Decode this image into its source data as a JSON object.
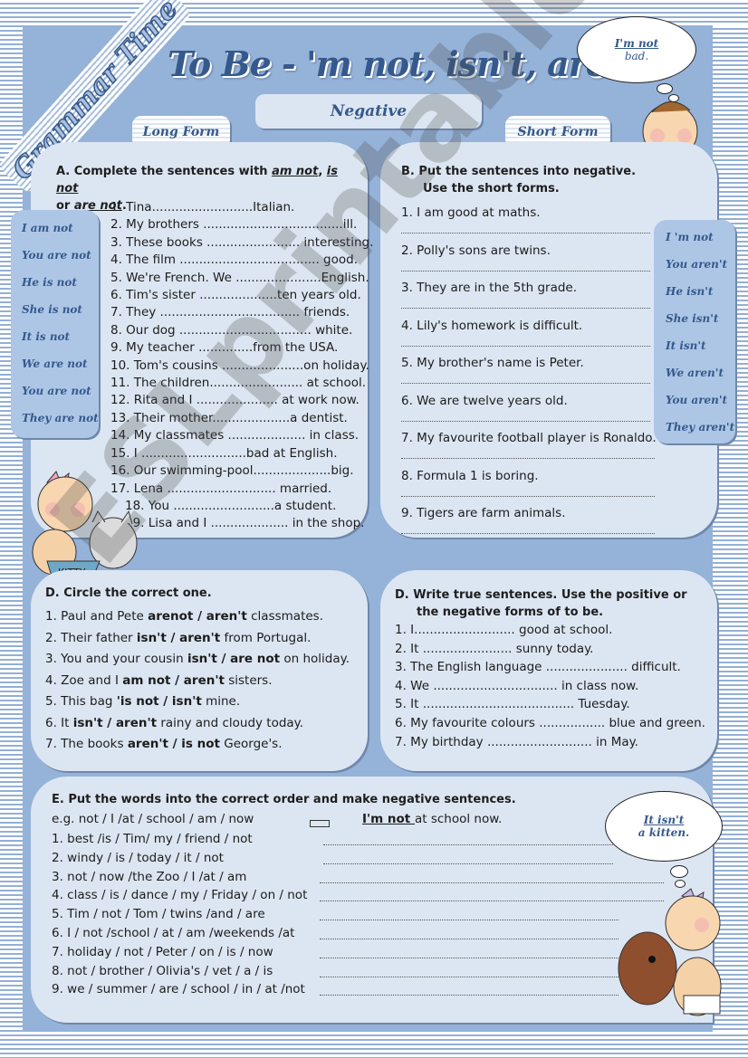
{
  "banner": "Grammar Time",
  "title": "To Be - 'm not, isn't, aren't",
  "header_pill": "Negative",
  "long_form_tab": "Long Form",
  "short_form_tab": "Short Form",
  "cloud_top": {
    "line1": "I'm not",
    "line2": "bad."
  },
  "cloud_bottom": {
    "line1": "It isn't",
    "line2": "a kitten."
  },
  "long_forms": [
    "I am not",
    "You are not",
    "He is not",
    "She is not",
    "It is not",
    "We are not",
    "You are not",
    "They are not"
  ],
  "short_forms": [
    "I 'm not",
    "You aren't",
    "He isn't",
    "She isn't",
    "It isn't",
    "We aren't",
    "You aren't",
    "They aren't"
  ],
  "section_a": {
    "title_pre": "A. Complete the sentences with ",
    "opt1": "am not",
    "sep": ",  ",
    "opt2": "is not",
    "or": "or ",
    "opt3": "are not",
    "end": ".",
    "items": [
      "1. Tina..........................Italian.",
      "2. My brothers ....................................ill.",
      "3. These books ........................ interesting.",
      "4. The film .................................... good.",
      "5. We're French. We ......................English.",
      "6. Tim's sister ....................ten years old.",
      "7. They .................................... friends.",
      "8. Our dog .................................. white.",
      "9. My teacher ..............from the USA.",
      "10. Tom's cousins .....................on holiday.",
      "11. The children........................ at school.",
      "12. Rita and I ..................... at work now.",
      "13. Their mother....................a dentist.",
      "14. My classmates .................... in class.",
      "15. I ...........................bad at English.",
      "16. Our swimming-pool....................big.",
      "17. Lena ............................ married.",
      "18. You ..........................a student.",
      "19. Lisa and I .................... in the shop."
    ]
  },
  "section_b": {
    "title_line1": "B. Put the sentences into negative.",
    "title_line2": "Use the short forms.",
    "items": [
      "1. I am good at maths.",
      "2. Polly's sons are twins.",
      "3. They are in the 5th grade.",
      "4. Lily's homework is difficult.",
      "5. My brother's name is Peter.",
      "6. We are twelve years old.",
      "7. My favourite football player is Ronaldo.",
      "8. Formula 1 is boring.",
      "9. Tigers are farm animals."
    ]
  },
  "section_c": {
    "title": "D. Circle the correct one.",
    "items": [
      {
        "pre": "1. Paul and Pete  ",
        "choice": "arenot / aren't",
        "post": " classmates."
      },
      {
        "pre": "2. Their father ",
        "choice": "isn't / aren't",
        "post": " from Portugal."
      },
      {
        "pre": "3. You and your cousin ",
        "choice": "isn't / are not",
        "post": " on holiday."
      },
      {
        "pre": "4. Zoe and I ",
        "choice": "am not / aren't",
        "post": " sisters."
      },
      {
        "pre": "5. This bag ",
        "choice": "'is not / isn't",
        "post": " mine."
      },
      {
        "pre": "6. It  ",
        "choice": "isn't / aren't",
        "post": " rainy and cloudy today."
      },
      {
        "pre": "7. The books ",
        "choice": "aren't / is not",
        "post": " George's."
      }
    ]
  },
  "section_d": {
    "title_line1": "D. Write true sentences. Use the positive or",
    "title_line2": "the negative forms of to be.",
    "items": [
      "1. I.......................... good at school.",
      "2. It ....................... sunny today.",
      "3. The English language ..................... difficult.",
      "4. We ................................ in class now.",
      "5. It ....................................... Tuesday.",
      "6. My favourite colours ................. blue and green.",
      "7. My birthday ........................... in May."
    ]
  },
  "section_e": {
    "title": "E. Put the words into the correct order and make negative sentences.",
    "example": "e.g. not / I /at / school / am / now",
    "example_answer_bold": "I'm not ",
    "example_answer_rest": "at school now.",
    "items": [
      "1. best /is / Tim/ my / friend / not",
      "2. windy / is / today / it / not",
      "3. not / now /the Zoo / I /at / am",
      "4. class / is / dance / my / Friday / on / not",
      "5. Tim / not / Tom / twins /and / are",
      "6. I / not /school / at / am /weekends /at",
      "7. holiday / not / Peter / on / is / now",
      "8. not / brother / Olivia's / vet / a / is",
      "9. we / summer / are / school / in / at /not"
    ]
  },
  "bowl_label": "KITTY",
  "watermark": "ESLprintables.com"
}
